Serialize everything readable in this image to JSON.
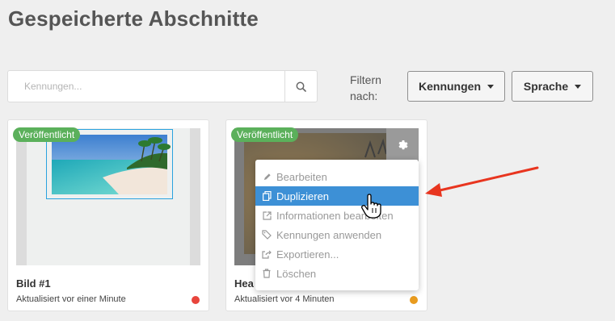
{
  "page": {
    "title": "Gespeicherte Abschnitte"
  },
  "search": {
    "placeholder": "Kennungen..."
  },
  "filter": {
    "label": "Filtern nach:",
    "tags_dropdown": "Kennungen",
    "language_dropdown": "Sprache"
  },
  "cards": [
    {
      "badge": "Veröffentlicht",
      "title": "Bild #1",
      "updated": "Aktualisiert vor einer Minute",
      "status_color": "#e8453c"
    },
    {
      "badge": "Veröffentlicht",
      "title": "Hea",
      "updated": "Aktualisiert vor 4 Minuten",
      "status_color": "#e89b1e"
    }
  ],
  "context_menu": {
    "items": [
      {
        "label": "Bearbeiten",
        "icon": "pencil-icon"
      },
      {
        "label": "Duplizieren",
        "icon": "copy-icon",
        "highlighted": true
      },
      {
        "label": "Informationen bearbeiten",
        "icon": "external-edit-icon"
      },
      {
        "label": "Kennungen anwenden",
        "icon": "tags-icon"
      },
      {
        "label": "Exportieren...",
        "icon": "export-icon"
      },
      {
        "label": "Löschen",
        "icon": "trash-icon"
      }
    ]
  },
  "colors": {
    "accent": "#3d90d6",
    "badge": "#5bb05b",
    "arrow": "#e8351f"
  }
}
